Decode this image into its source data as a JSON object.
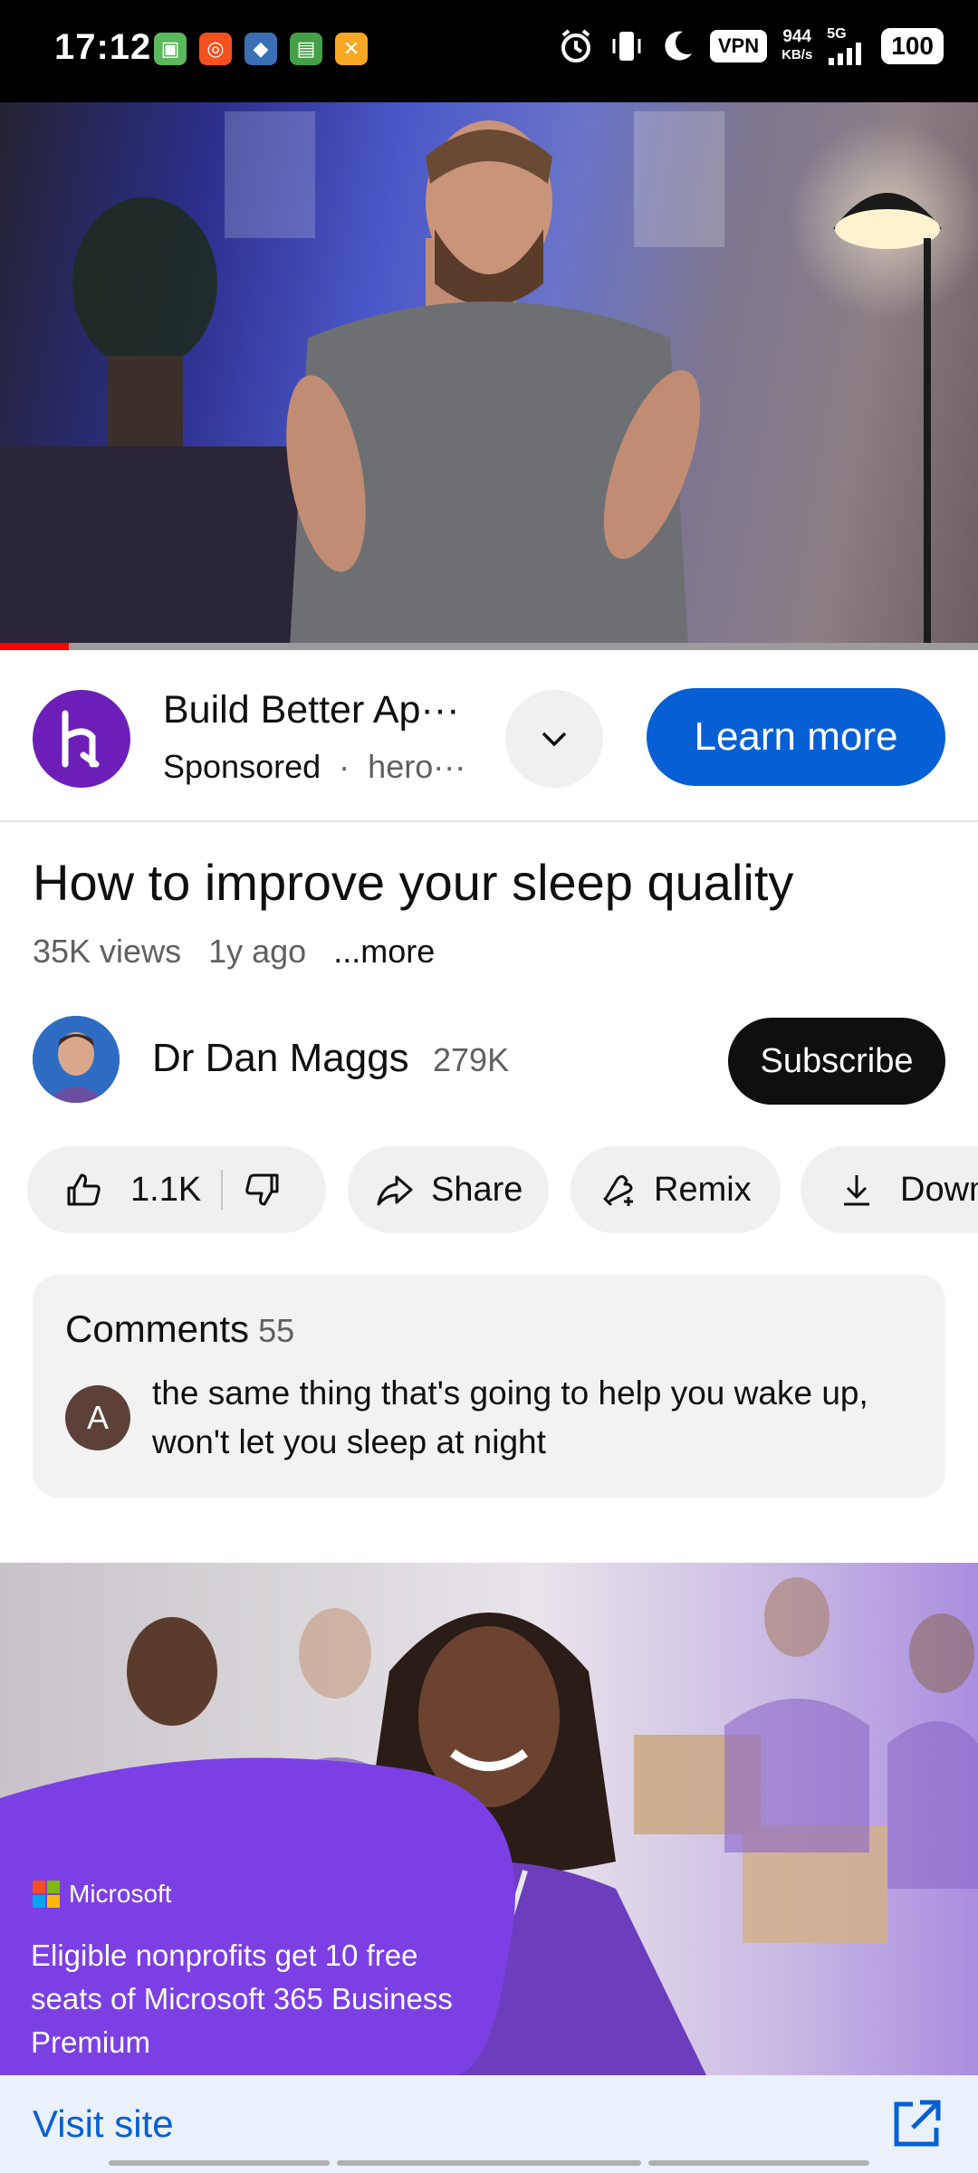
{
  "status_bar": {
    "time": "17:12",
    "vpn": "VPN",
    "speed_value": "944",
    "speed_unit": "KB/s",
    "network": "5G",
    "battery": "100",
    "icons": [
      "alarm-icon",
      "vibrate-icon",
      "moon-icon",
      "signal-icon"
    ]
  },
  "ad": {
    "title": "Build Better Ap···",
    "sponsored": "Sponsored",
    "separator": "·",
    "source": "hero···",
    "cta": "Learn more",
    "logo_color": "#6b1fb8"
  },
  "video": {
    "title": "How to improve your sleep quality",
    "views": "35K views",
    "age": "1y ago",
    "more": "...more",
    "progress_fraction": 0.07
  },
  "channel": {
    "name": "Dr Dan Maggs",
    "subscribers": "279K",
    "subscribe_label": "Subscribe"
  },
  "actions": {
    "likes": "1.1K",
    "share": "Share",
    "remix": "Remix",
    "download": "Down"
  },
  "comments": {
    "label": "Comments",
    "count": "55",
    "top_comment_avatar": "A",
    "top_comment": "the same thing that's going to help you wake up, won't let you sleep at night"
  },
  "bottom_ad": {
    "brand": "Microsoft",
    "copy": "Eligible nonprofits get 10 free seats of Microsoft 365 Business Premium",
    "visit": "Visit site"
  },
  "colors": {
    "accent_blue": "#065fd4",
    "progress_red": "#ff0000",
    "microsoft_purple": "#7b3fe4"
  }
}
